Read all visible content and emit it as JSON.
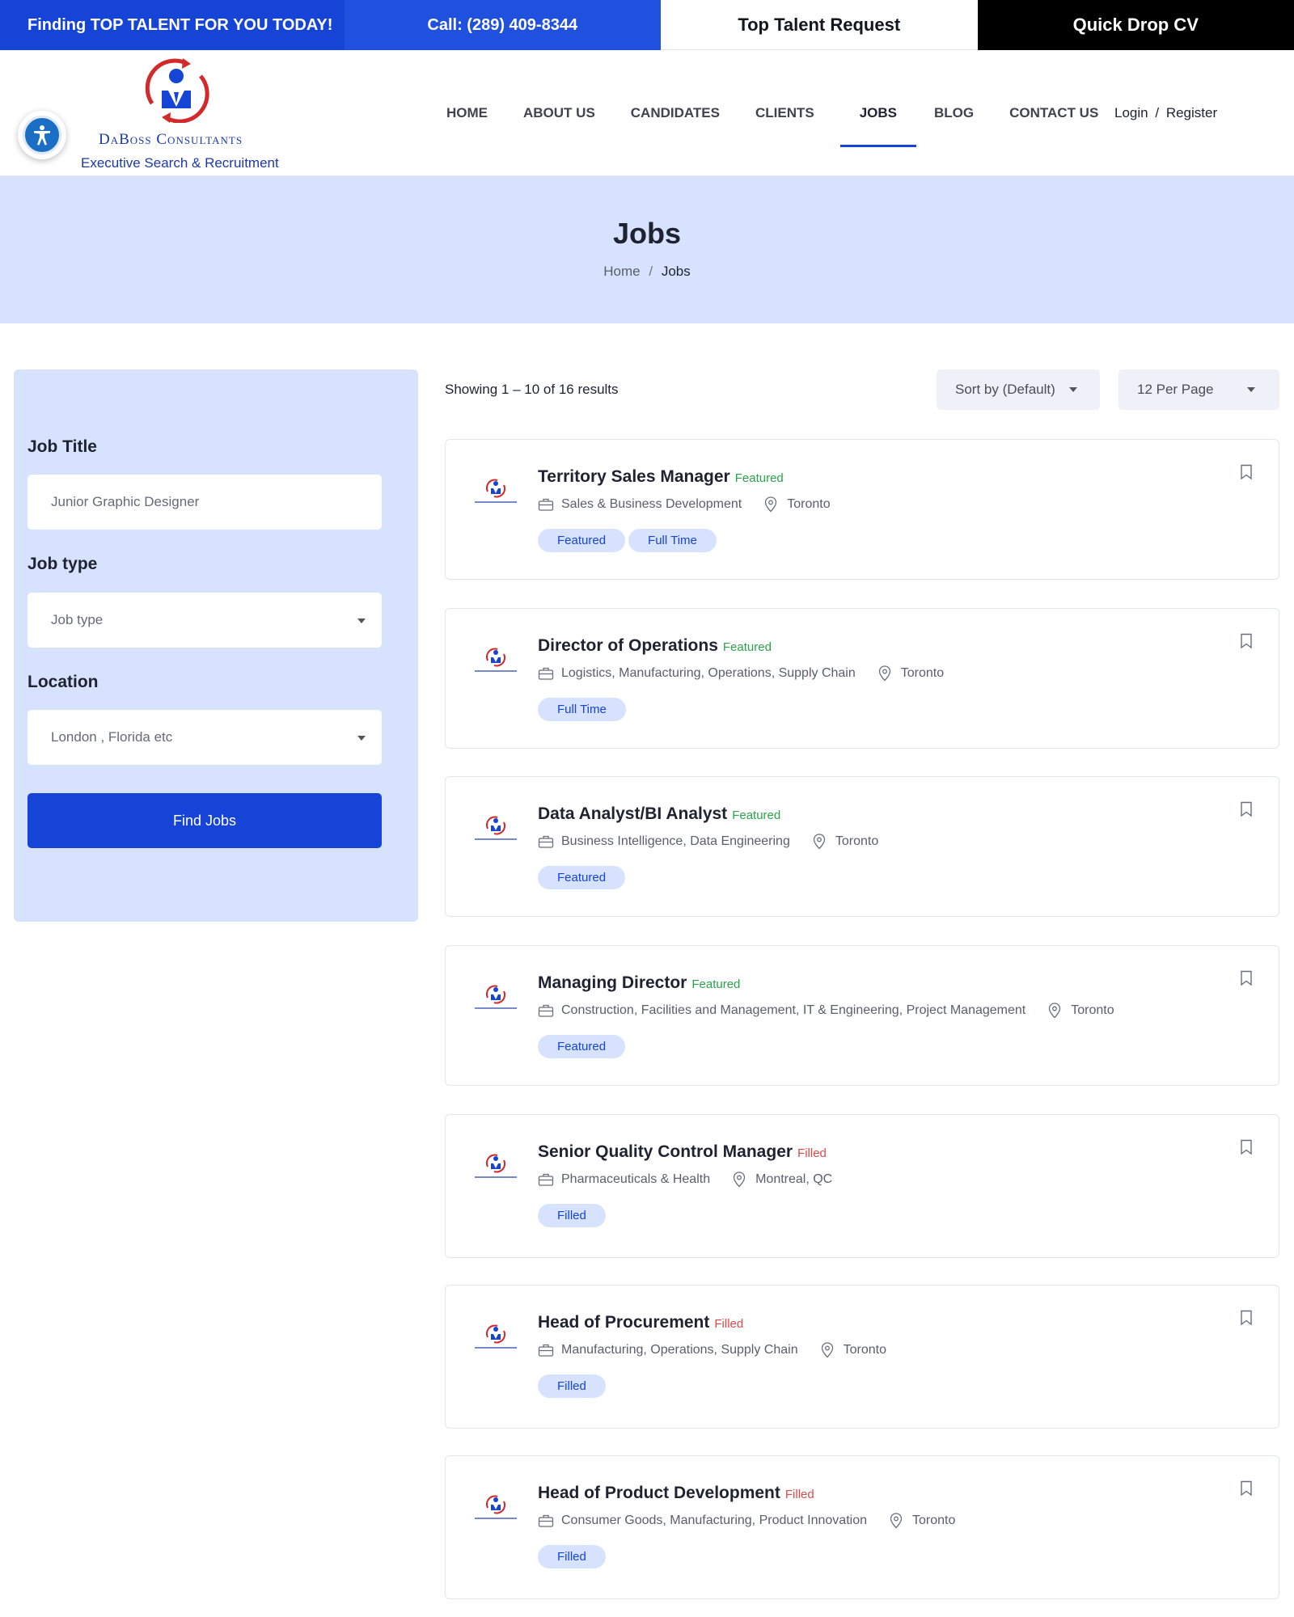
{
  "topbar": {
    "tagline": "Finding TOP TALENT FOR YOU TODAY!",
    "phone": "Call: (289) 409-8344",
    "talent_request": "Top Talent Request",
    "quick_drop": "Quick Drop CV"
  },
  "brand": {
    "name": "DaBoss Consultants",
    "tagline": "Executive Search & Recruitment",
    "primary_color": "#1544d6",
    "accent_color": "#d7e2ff"
  },
  "nav": {
    "items": [
      "HOME",
      "ABOUT US",
      "CANDIDATES",
      "CLIENTS",
      "JOBS",
      "BLOG",
      "CONTACT US"
    ],
    "active": "JOBS",
    "login": "Login",
    "register": "Register",
    "separator": "/"
  },
  "banner": {
    "title": "Jobs",
    "breadcrumb_home": "Home",
    "breadcrumb_sep": "/",
    "breadcrumb_current": "Jobs"
  },
  "filter": {
    "job_title_label": "Job Title",
    "job_title_placeholder": "Junior Graphic Designer",
    "job_type_label": "Job type",
    "job_type_placeholder": "Job type",
    "location_label": "Location",
    "location_placeholder": "London , Florida etc",
    "submit": "Find Jobs"
  },
  "results": {
    "info": "Showing 1 – 10 of 16 results",
    "sort": "Sort by (Default)",
    "per_page": "12 Per Page"
  },
  "jobs": [
    {
      "title": "Territory Sales Manager",
      "status": "Featured",
      "category": "Sales & Business Development",
      "location": "Toronto",
      "tags": [
        "Featured",
        "Full Time"
      ]
    },
    {
      "title": "Director of Operations",
      "status": "Featured",
      "category": "Logistics, Manufacturing, Operations, Supply Chain",
      "location": "Toronto",
      "tags": [
        "Full Time"
      ]
    },
    {
      "title": "Data Analyst/BI Analyst",
      "status": "Featured",
      "category": "Business Intelligence, Data Engineering",
      "location": "Toronto",
      "tags": [
        "Featured"
      ]
    },
    {
      "title": "Managing Director",
      "status": "Featured",
      "category": "Construction, Facilities and Management, IT & Engineering, Project Management",
      "location": "Toronto",
      "tags": [
        "Featured"
      ]
    },
    {
      "title": "Senior Quality Control Manager",
      "status": "Filled",
      "category": "Pharmaceuticals & Health",
      "location": "Montreal, QC",
      "tags": [
        "Filled"
      ]
    },
    {
      "title": "Head of Procurement",
      "status": "Filled",
      "category": "Manufacturing, Operations, Supply Chain",
      "location": "Toronto",
      "tags": [
        "Filled"
      ]
    },
    {
      "title": "Head of Product Development",
      "status": "Filled",
      "category": "Consumer Goods, Manufacturing, Product Innovation",
      "location": "Toronto",
      "tags": [
        "Filled"
      ]
    }
  ]
}
